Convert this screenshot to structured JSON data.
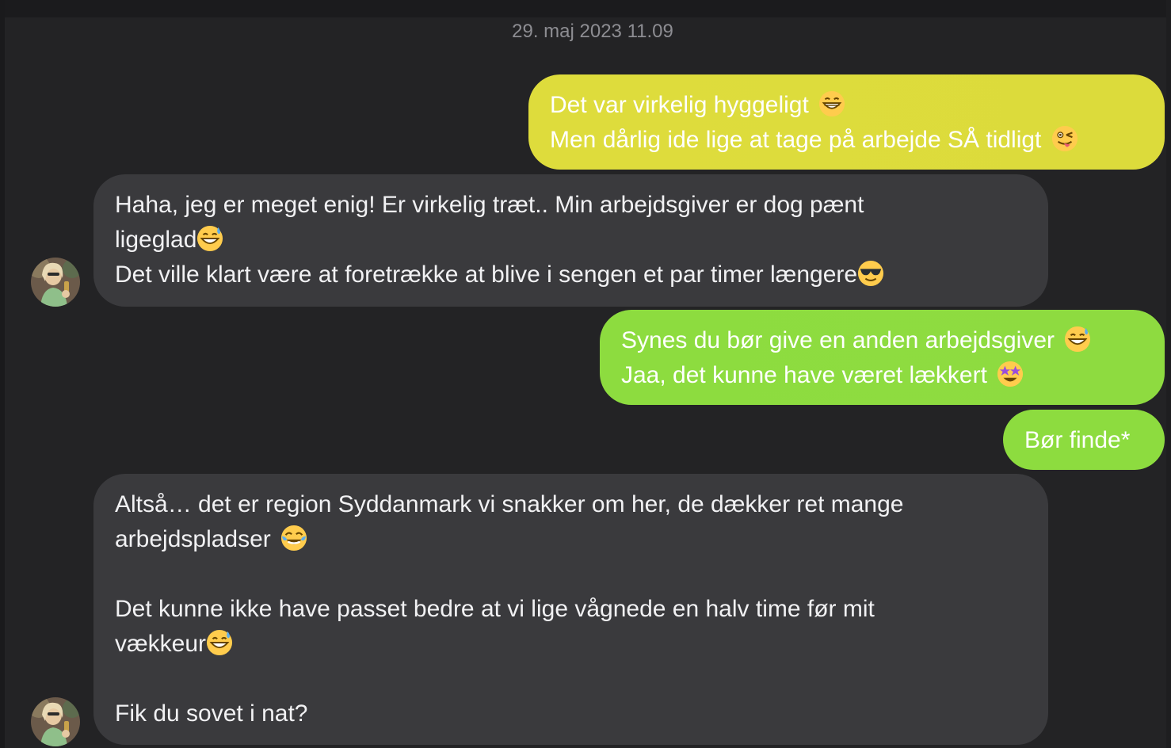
{
  "timestamp": "29. maj 2023 11.09",
  "colors": {
    "background": "#232325",
    "incoming_bubble": "#3a3a3d",
    "outgoing_bubble_yellow": "#dedc3c",
    "outgoing_bubble_green": "#8ddc3f",
    "timestamp_text": "#8d8d92"
  },
  "messages": [
    {
      "direction": "outgoing",
      "lines": [
        {
          "text": "Det var virkelig hyggeligt ",
          "emoji": "grinning-face-icon"
        },
        {
          "text": "Men dårlig ide lige at tage på arbejde SÅ tidligt ",
          "emoji": "winking-tongue-face-icon"
        }
      ]
    },
    {
      "direction": "incoming",
      "avatar": "contact-avatar",
      "lines": [
        {
          "text": "Haha, jeg er meget enig! Er virkelig træt.. Min arbejdsgiver er dog pænt"
        },
        {
          "text": "ligeglad",
          "emoji": "grinning-sweat-face-icon"
        },
        {
          "text": "Det ville klart være at foretrække at blive i sengen et par timer længere",
          "emoji": "sunglasses-face-icon"
        }
      ]
    },
    {
      "direction": "outgoing",
      "lines": [
        {
          "text": "Synes du bør give en anden arbejdsgiver ",
          "emoji": "grinning-sweat-face-icon"
        },
        {
          "text": "Jaa, det kunne have været lækkert ",
          "emoji": "star-struck-face-icon"
        }
      ]
    },
    {
      "direction": "outgoing",
      "lines": [
        {
          "text": "Bør finde*"
        }
      ]
    },
    {
      "direction": "incoming",
      "avatar": "contact-avatar",
      "lines": [
        {
          "text": "Altså… det er region Syddanmark vi snakker om her, de dækker ret mange"
        },
        {
          "text": "arbejdspladser ",
          "emoji": "tears-of-joy-face-icon"
        },
        {
          "text": ""
        },
        {
          "text": "Det kunne ikke have passet bedre at vi lige vågnede en halv time før mit"
        },
        {
          "text": "vækkeur",
          "emoji": "grinning-sweat-face-icon"
        },
        {
          "text": ""
        },
        {
          "text": "Fik du sovet i nat?"
        }
      ]
    }
  ]
}
